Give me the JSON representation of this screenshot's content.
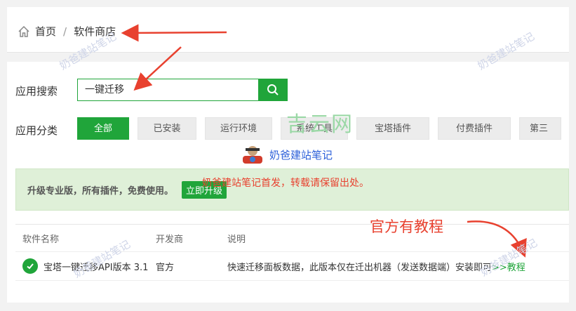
{
  "breadcrumb": {
    "home": "首页",
    "sep": "/",
    "current": "软件商店"
  },
  "search": {
    "label": "应用搜索",
    "value": "一键迁移"
  },
  "category": {
    "label": "应用分类",
    "items": [
      "全部",
      "已安装",
      "运行环境",
      "系统工具",
      "宝塔插件",
      "付费插件",
      "第三"
    ]
  },
  "promo": {
    "text": "升级专业版，所有插件，免费使用。",
    "button": "立即升级"
  },
  "table": {
    "headers": [
      "软件名称",
      "开发商",
      "说明"
    ],
    "row": {
      "name": "宝塔一键迁移API版本 3.1",
      "developer": "官方",
      "desc": "快速迁移面板数据，此版本仅在迁出机器（发送数据端）安装即可",
      "link": ">>教程"
    }
  },
  "overlay": {
    "site_mark": "奶爸建站笔记",
    "notice": "奶爸建站笔记首发，转载请保留出处。",
    "callout": "官方有教程",
    "logo": "吉云网"
  },
  "colors": {
    "accent": "#20a53a",
    "annotation": "#e8412f"
  }
}
